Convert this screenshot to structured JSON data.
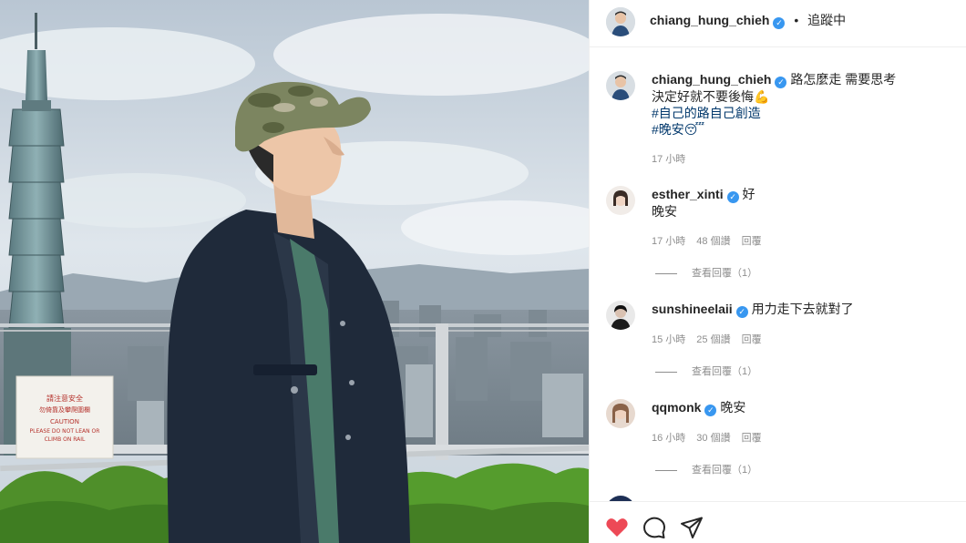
{
  "post": {
    "author": "chiang_hung_chieh",
    "follow_status": "追蹤中",
    "separator": "•",
    "caption_lines": [
      "路怎麼走 需要思考",
      "決定好就不要後悔💪"
    ],
    "hashtags": [
      "#自己的路自己創造",
      "#晚安😴"
    ],
    "time": "17 小時"
  },
  "comments": [
    {
      "user": "esther_xinti",
      "text_line1": "好",
      "text_line2": "晚安",
      "time": "17 小時",
      "likes": "48 個讚",
      "reply": "回覆",
      "view_replies": "查看回覆（1）"
    },
    {
      "user": "sunshineelaii",
      "text_line1": "用力走下去就對了",
      "text_line2": "",
      "time": "15 小時",
      "likes": "25 個讚",
      "reply": "回覆",
      "view_replies": "查看回覆（1）"
    },
    {
      "user": "qqmonk",
      "text_line1": "晚安",
      "text_line2": "",
      "time": "16 小時",
      "likes": "30 個讚",
      "reply": "回覆",
      "view_replies": "查看回覆（1）"
    }
  ],
  "sign": {
    "line1": "請注意安全",
    "line2": "勿倚靠及攀爬圍欄",
    "line3": "CAUTION",
    "line4": "PLEASE DO NOT LEAN OR",
    "line5": "CLIMB ON RAIL"
  },
  "colors": {
    "verified": "#3897f0",
    "heart": "#ed4956",
    "hashtag": "#00376b",
    "muted": "#8e8e8e"
  },
  "icons": [
    "verified-badge-icon",
    "heart-icon",
    "comment-icon",
    "share-icon"
  ]
}
